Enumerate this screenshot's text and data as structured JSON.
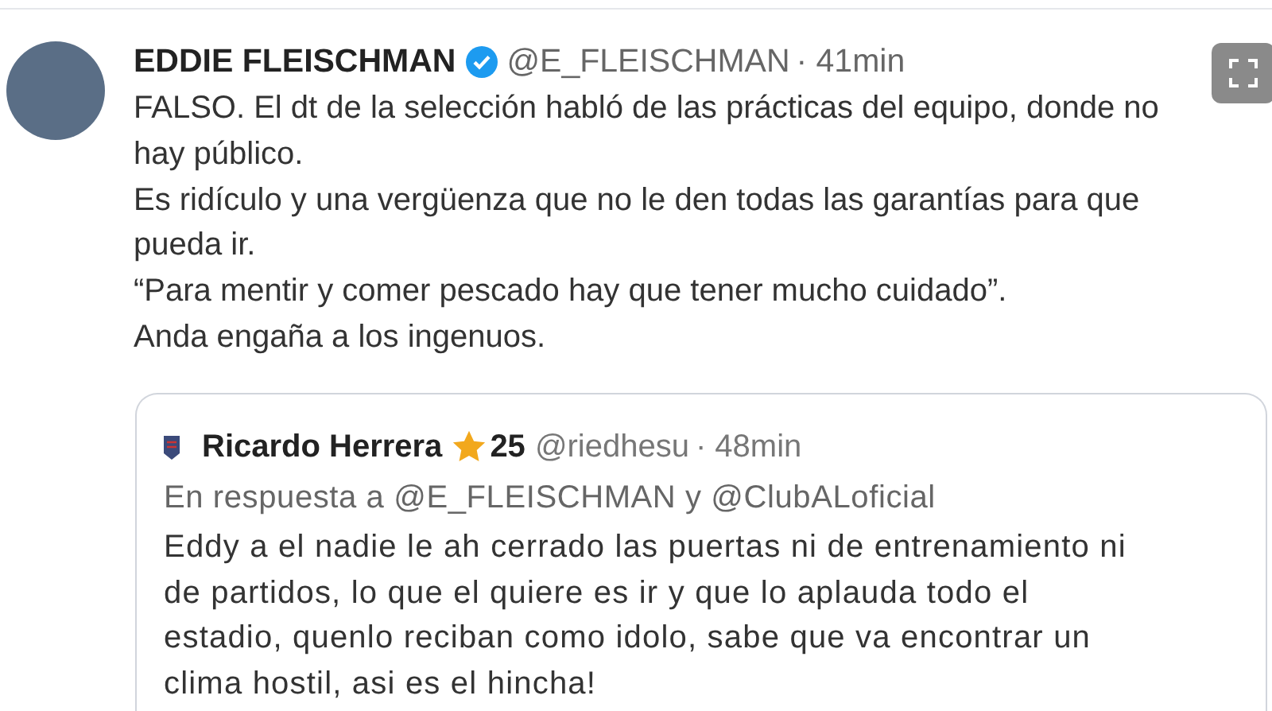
{
  "tweet": {
    "name": "EDDIE FLEISCHMAN",
    "verified": true,
    "handle": "@E_FLEISCHMAN",
    "time": "· 41min",
    "paragraphs": [
      "FALSO. El dt de la selección habló de las prácticas del equipo, donde no hay público.",
      "Es ridículo y una vergüenza que no le den todas las garantías para que pueda ir.",
      "“Para mentir y comer pescado hay que tener mucho cuidado”.",
      "Anda engaña a los ingenuos."
    ]
  },
  "quoted_tweet": {
    "name": "Ricardo Herrera",
    "badge": "25",
    "handle": "@riedhesu",
    "time": "· 48min",
    "reply_to": "En respuesta a @E_FLEISCHMAN y @ClubALoficial",
    "text": "Eddy a el nadie le ah cerrado las puertas ni de entrenamiento ni de partidos, lo que el quiere es ir y que lo aplauda todo el estadio, quenlo reciban como idolo, sabe que va encontrar un clima hostil, asi es el hincha!"
  }
}
